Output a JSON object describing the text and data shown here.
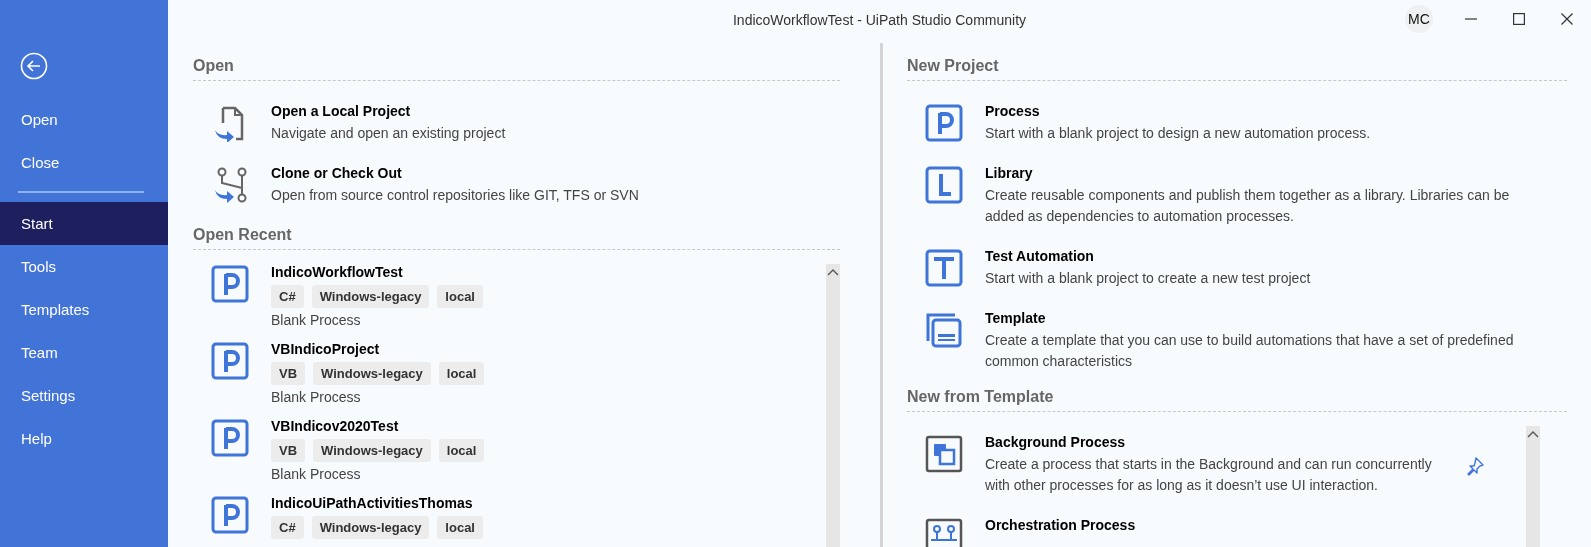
{
  "window": {
    "title": "IndicoWorkflowTest - UiPath Studio Community",
    "user_initials": "MC"
  },
  "sidebar": {
    "top_items": [
      {
        "label": "Open",
        "selected": false
      },
      {
        "label": "Close",
        "selected": false
      }
    ],
    "items": [
      {
        "label": "Start",
        "selected": true
      },
      {
        "label": "Tools",
        "selected": false
      },
      {
        "label": "Templates",
        "selected": false
      },
      {
        "label": "Team",
        "selected": false
      },
      {
        "label": "Settings",
        "selected": false
      },
      {
        "label": "Help",
        "selected": false
      }
    ]
  },
  "open": {
    "heading": "Open",
    "items": [
      {
        "kind": "file",
        "title": "Open a Local Project",
        "description": "Navigate and open an existing project"
      },
      {
        "kind": "branch",
        "title": "Clone or Check Out",
        "description": "Open from source control repositories like GIT, TFS or SVN"
      }
    ]
  },
  "open_recent": {
    "heading": "Open Recent",
    "items": [
      {
        "name": "IndicoWorkflowTest",
        "tags": [
          "C#",
          "Windows-legacy",
          "local"
        ],
        "description": "Blank Process"
      },
      {
        "name": "VBIndicoProject",
        "tags": [
          "VB",
          "Windows-legacy",
          "local"
        ],
        "description": "Blank Process"
      },
      {
        "name": "VBIndicov2020Test",
        "tags": [
          "VB",
          "Windows-legacy",
          "local"
        ],
        "description": "Blank Process"
      },
      {
        "name": "IndicoUiPathActivitiesThomas",
        "tags": [
          "C#",
          "Windows-legacy",
          "local"
        ]
      }
    ]
  },
  "new_project": {
    "heading": "New Project",
    "items": [
      {
        "kind": "process",
        "title": "Process",
        "description": "Start with a blank project to design a new automation process."
      },
      {
        "kind": "library",
        "title": "Library",
        "description": "Create reusable components and publish them together as a library. Libraries can be added as dependencies to automation processes."
      },
      {
        "kind": "test",
        "title": "Test Automation",
        "description": "Start with a blank project to create a new test project"
      },
      {
        "kind": "template",
        "title": "Template",
        "description": "Create a template that you can use to build automations that have a set of predefined common characteristics"
      }
    ]
  },
  "new_from_template": {
    "heading": "New from Template",
    "items": [
      {
        "kind": "background",
        "title": "Background Process",
        "description": "Create a process that starts in the Background and can run concurrently with other processes for as long as it doesn’t use UI interaction."
      },
      {
        "kind": "orchestration",
        "title": "Orchestration Process"
      }
    ]
  }
}
